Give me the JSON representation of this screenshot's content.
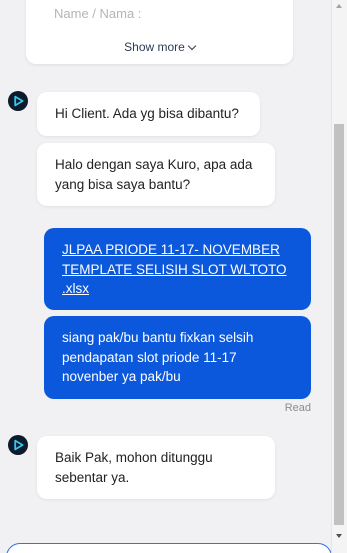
{
  "form": {
    "name_label": "Name / Nama :",
    "show_more": "Show more"
  },
  "messages": [
    {
      "sender": "bot",
      "text": "Hi Client. Ada yg bisa dibantu?"
    },
    {
      "sender": "bot",
      "text": "Halo dengan saya Kuro, apa ada yang bisa saya bantu?"
    },
    {
      "sender": "user",
      "type": "file",
      "text": "JLPAA PRIODE 11-17- NOVEMBER TEMPLATE SELISIH SLOT WLTOTO .xlsx"
    },
    {
      "sender": "user",
      "text": "siang pak/bu bantu fixkan selsih pendapatan slot priode 11-17 novenber ya pak/bu"
    },
    {
      "sender": "bot",
      "text": "Baik Pak, mohon ditunggu sebentar ya."
    }
  ],
  "read_receipt": "Read",
  "colors": {
    "user_bubble": "#0b58dd",
    "bot_bubble": "#ffffff",
    "background": "#f1f1f3",
    "avatar_bg": "#0d1b2a"
  },
  "icons": {
    "avatar": "play-logo-icon",
    "show_more": "chevron-down-icon"
  }
}
